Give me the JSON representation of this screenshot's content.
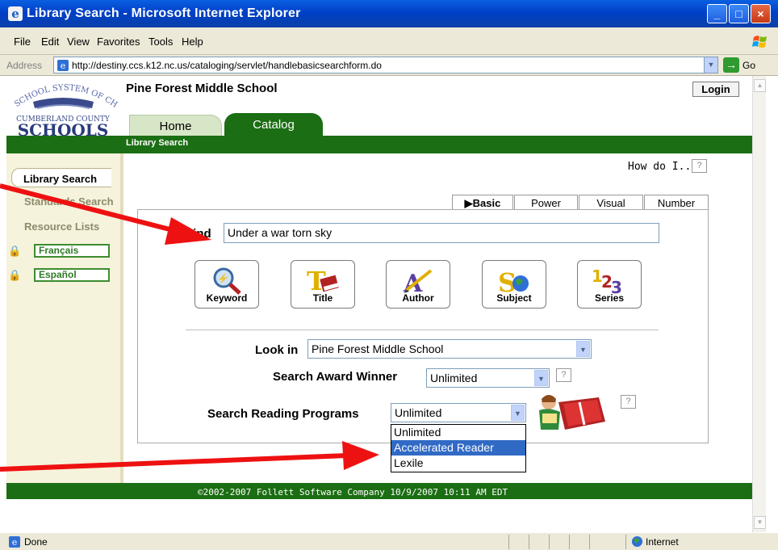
{
  "window": {
    "title": "Library Search - Microsoft Internet Explorer",
    "min_symbol": "_",
    "max_symbol": "□",
    "close_symbol": "×"
  },
  "menu": [
    "File",
    "Edit",
    "View",
    "Favorites",
    "Tools",
    "Help"
  ],
  "address": {
    "label": "Address",
    "url": "http://destiny.ccs.k12.nc.us/cataloging/servlet/handlebasicsearchform.do",
    "go_label": "Go"
  },
  "header": {
    "school_name": "Pine Forest Middle School",
    "login": "Login",
    "tabs": [
      "Home",
      "Catalog"
    ],
    "breadcrumb": "Library Search",
    "logo": {
      "top_text": "SCHOOL SYSTEM OF CHOICE",
      "mid_text": "CUMBERLAND COUNTY",
      "big_text": "SCHOOLS"
    }
  },
  "sidebar": {
    "items": [
      "Library Search",
      "Standards Search",
      "Resource Lists"
    ],
    "languages": [
      "Français",
      "Español"
    ]
  },
  "help": {
    "how_do_i": "How do I...",
    "q": "?"
  },
  "search_tabs": [
    "▶Basic",
    "Power",
    "Visual",
    "Number"
  ],
  "find": {
    "label": "Find",
    "value": "Under a war torn sky"
  },
  "categories": [
    "Keyword",
    "Title",
    "Author",
    "Subject",
    "Series"
  ],
  "look_in": {
    "label": "Look in",
    "value": "Pine Forest Middle School"
  },
  "award": {
    "label": "Search Award Winner",
    "value": "Unlimited"
  },
  "reading": {
    "label": "Search Reading Programs",
    "value": "Unlimited",
    "options": [
      "Unlimited",
      "Accelerated Reader",
      "Lexile"
    ]
  },
  "footer": "©2002-2007 Follett Software Company   10/9/2007 10:11 AM EDT",
  "status": {
    "text": "Done",
    "zone": "Internet"
  },
  "colors": {
    "green": "#1b6e13",
    "highlight": "#316ac5",
    "arrow": "#ee1111"
  }
}
